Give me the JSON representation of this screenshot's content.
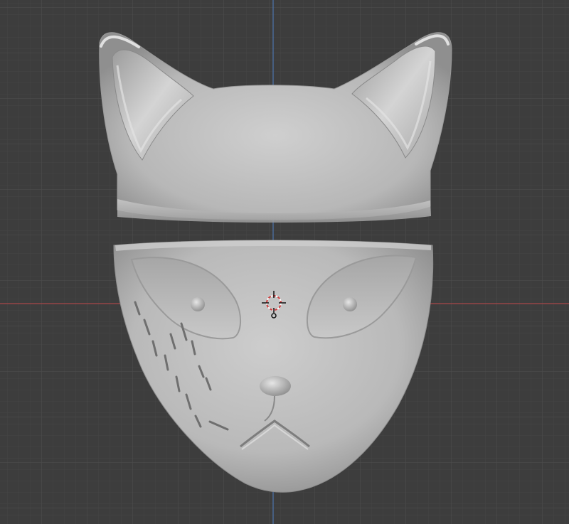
{
  "viewport": {
    "background": "#3d3d3d",
    "grid_color": "#4a4a4a",
    "x_axis_color": "#b04648",
    "y_axis_color": "#4f79b3"
  },
  "model": {
    "parts": [
      "mask-top-ears",
      "mask-bottom-face"
    ],
    "material_color": "#bcbcbc"
  },
  "cursor": {
    "icon": "3d-cursor-icon"
  }
}
